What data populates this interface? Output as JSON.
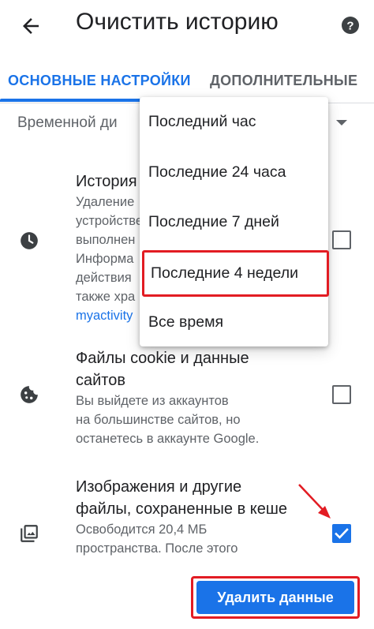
{
  "header": {
    "title": "Очистить историю",
    "back_icon": "arrow-back-icon",
    "help_icon": "help-icon"
  },
  "tabs": [
    {
      "label": "ОСНОВНЫЕ НАСТРОЙКИ",
      "active": true
    },
    {
      "label": "ДОПОЛНИТЕЛЬНЫЕ",
      "active": false
    }
  ],
  "time_range": {
    "label": "Временной ди",
    "selected": "Последние 4 недели"
  },
  "rows": [
    {
      "title": "История",
      "desc_lines": [
        "Удаление",
        "устройстве",
        "выполнен",
        "Информа",
        "действия",
        "также хра"
      ],
      "link": "myactivity",
      "icon": "clock-icon",
      "checked": false
    },
    {
      "title_lines": [
        "Файлы cookie и данные",
        "сайтов"
      ],
      "desc_lines": [
        "Вы выйдете из аккаунтов",
        "на большинстве сайтов, но",
        "останетесь в аккаунте Google."
      ],
      "icon": "cookie-icon",
      "checked": false
    },
    {
      "title_lines": [
        "Изображения и другие",
        "файлы, сохраненные в кеше"
      ],
      "desc_lines": [
        "Освободится 20,4 МБ",
        "пространства. После этого"
      ],
      "icon": "image-icon",
      "checked": true
    }
  ],
  "dropdown": {
    "options": [
      "Последний час",
      "Последние 24 часа",
      "Последние 7 дней",
      "Последние 4 недели",
      "Все время"
    ],
    "highlighted_index": 3
  },
  "action": {
    "label": "Удалить данные"
  },
  "colors": {
    "accent": "#1a73e8",
    "highlight": "#e21c23",
    "text": "#202124",
    "secondary": "#5f6368"
  }
}
